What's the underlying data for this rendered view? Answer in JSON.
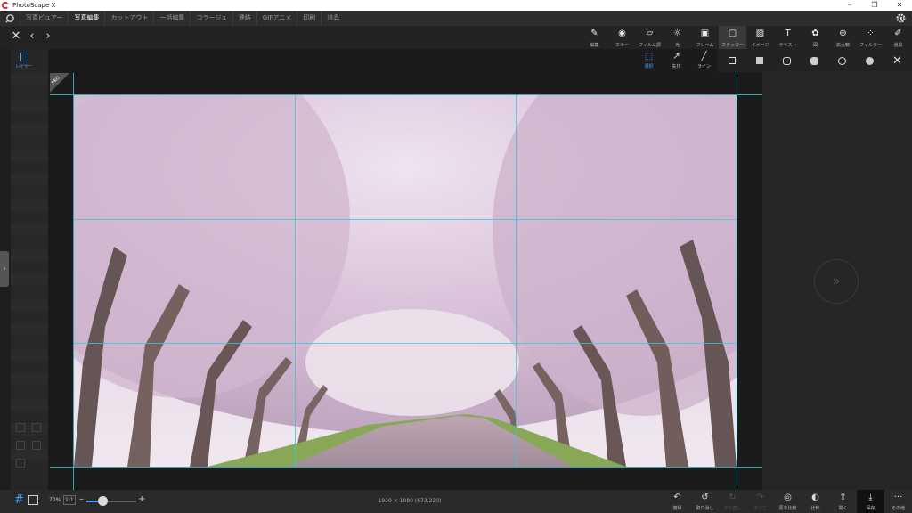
{
  "window": {
    "title": "PhotoScape X",
    "controls": [
      "–",
      "❐",
      "✕"
    ]
  },
  "menu": {
    "tabs": [
      {
        "label": "写真ビュアー",
        "active": false
      },
      {
        "label": "写真編集",
        "active": true
      },
      {
        "label": "カットアウト",
        "active": false
      },
      {
        "label": "一括編集",
        "active": false
      },
      {
        "label": "コラージュ",
        "active": false
      },
      {
        "label": "連結",
        "active": false
      },
      {
        "label": "GIFアニメ",
        "active": false
      },
      {
        "label": "印刷",
        "active": false
      },
      {
        "label": "道具",
        "active": false
      }
    ]
  },
  "nav": {
    "close": "✕",
    "back": "‹",
    "forward": "›"
  },
  "tools": [
    {
      "label": "編集",
      "icon": "✎"
    },
    {
      "label": "カラー",
      "icon": "◉"
    },
    {
      "label": "フィルム調",
      "icon": "▱"
    },
    {
      "label": "光",
      "icon": "☼"
    },
    {
      "label": "フレーム",
      "icon": "▣"
    },
    {
      "label": "ステッカー",
      "icon": "▢",
      "active": true
    },
    {
      "label": "イメージ",
      "icon": "▨"
    },
    {
      "label": "テキスト",
      "icon": "T"
    },
    {
      "label": "図",
      "icon": "✿"
    },
    {
      "label": "拡大鏡",
      "icon": "⊕"
    },
    {
      "label": "フィルター",
      "icon": "⁘"
    },
    {
      "label": "道具",
      "icon": "✐"
    }
  ],
  "layer_panel": {
    "label": "レイヤー"
  },
  "sub_tools": [
    {
      "label": "選択",
      "icon": "⬚",
      "active": true
    },
    {
      "label": "矢印",
      "icon": "↗"
    },
    {
      "label": "ライン",
      "icon": "╱"
    }
  ],
  "canvas": {
    "pro_badge": "PRO"
  },
  "bottom": {
    "zoom_label": "70%",
    "one_to_one": "1:1",
    "zoom_fraction": 0.32,
    "dimensions": "1920 × 1080 (673,220)"
  },
  "bottom_tools": [
    {
      "label": "復帰",
      "icon": "↶",
      "disabled": false
    },
    {
      "label": "取り消し",
      "icon": "↺",
      "disabled": false
    },
    {
      "label": "やり直し",
      "icon": "↻",
      "disabled": true
    },
    {
      "label": "すべて",
      "icon": "↷",
      "disabled": true
    },
    {
      "label": "原本比較",
      "icon": "◎",
      "disabled": false
    },
    {
      "label": "比較",
      "icon": "◐",
      "disabled": false
    },
    {
      "label": "開く",
      "icon": "⇪",
      "disabled": false
    },
    {
      "label": "保存",
      "icon": "⤓",
      "disabled": false,
      "highlight": true
    },
    {
      "label": "その他",
      "icon": "···",
      "disabled": false
    }
  ],
  "colors": {
    "accent": "#4aa3ff",
    "guide": "#3cc8d6",
    "background": "#1e1e1e"
  }
}
